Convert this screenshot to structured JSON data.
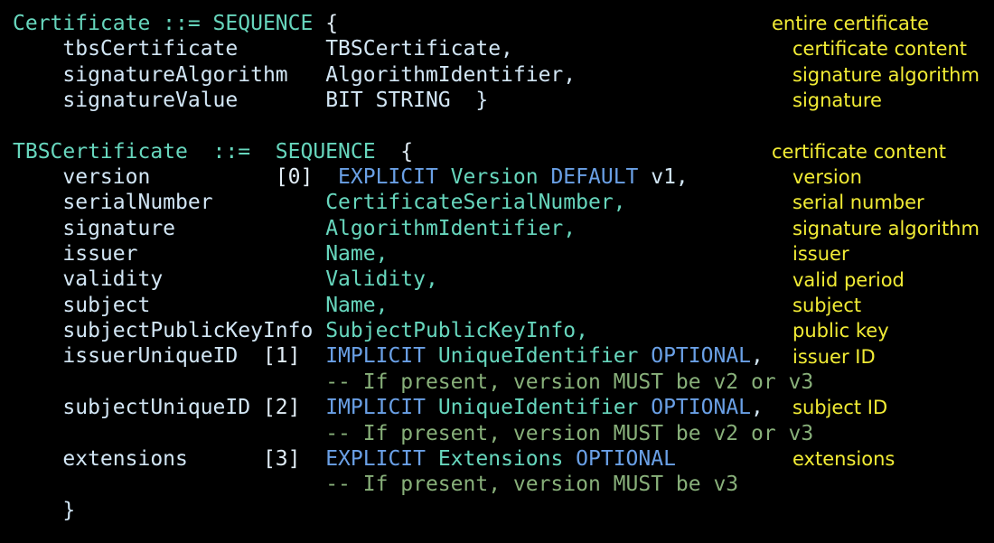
{
  "code": [
    [
      {
        "t": "Certificate ::= SEQUENCE ",
        "c": "kw-type"
      },
      {
        "t": "{",
        "c": "punct"
      }
    ],
    [
      {
        "t": "    tbsCertificate       ",
        "c": "field"
      },
      {
        "t": "TBSCertificate,",
        "c": "field"
      }
    ],
    [
      {
        "t": "    signatureAlgorithm   ",
        "c": "field"
      },
      {
        "t": "AlgorithmIdentifier,",
        "c": "field"
      }
    ],
    [
      {
        "t": "    signatureValue       ",
        "c": "field"
      },
      {
        "t": "BIT STRING  }",
        "c": "field"
      }
    ],
    [],
    [
      {
        "t": "TBSCertificate  ::=  SEQUENCE  ",
        "c": "kw-type"
      },
      {
        "t": "{",
        "c": "punct"
      }
    ],
    [
      {
        "t": "    version          ",
        "c": "field"
      },
      {
        "t": "[0]  ",
        "c": "punct"
      },
      {
        "t": "EXPLICIT ",
        "c": "kw-blue"
      },
      {
        "t": "Version ",
        "c": "kw-type"
      },
      {
        "t": "DEFAULT ",
        "c": "kw-blue"
      },
      {
        "t": "v1,",
        "c": "field"
      }
    ],
    [
      {
        "t": "    serialNumber         ",
        "c": "field"
      },
      {
        "t": "CertificateSerialNumber,",
        "c": "kw-type"
      }
    ],
    [
      {
        "t": "    signature            ",
        "c": "field"
      },
      {
        "t": "AlgorithmIdentifier,",
        "c": "kw-type"
      }
    ],
    [
      {
        "t": "    issuer               ",
        "c": "field"
      },
      {
        "t": "Name,",
        "c": "kw-type"
      }
    ],
    [
      {
        "t": "    validity             ",
        "c": "field"
      },
      {
        "t": "Validity,",
        "c": "kw-type"
      }
    ],
    [
      {
        "t": "    subject              ",
        "c": "field"
      },
      {
        "t": "Name,",
        "c": "kw-type"
      }
    ],
    [
      {
        "t": "    subjectPublicKeyInfo ",
        "c": "field"
      },
      {
        "t": "SubjectPublicKeyInfo,",
        "c": "kw-type"
      }
    ],
    [
      {
        "t": "    issuerUniqueID  ",
        "c": "field"
      },
      {
        "t": "[1]  ",
        "c": "punct"
      },
      {
        "t": "IMPLICIT ",
        "c": "kw-blue"
      },
      {
        "t": "UniqueIdentifier ",
        "c": "kw-type"
      },
      {
        "t": "OPTIONAL",
        "c": "kw-blue"
      },
      {
        "t": ",",
        "c": "field"
      }
    ],
    [
      {
        "t": "                         ",
        "c": "field"
      },
      {
        "t": "-- If present, version MUST be v2 or v3",
        "c": "comment"
      }
    ],
    [
      {
        "t": "    subjectUniqueID ",
        "c": "field"
      },
      {
        "t": "[2]  ",
        "c": "punct"
      },
      {
        "t": "IMPLICIT ",
        "c": "kw-blue"
      },
      {
        "t": "UniqueIdentifier ",
        "c": "kw-type"
      },
      {
        "t": "OPTIONAL",
        "c": "kw-blue"
      },
      {
        "t": ",",
        "c": "field"
      }
    ],
    [
      {
        "t": "                         ",
        "c": "field"
      },
      {
        "t": "-- If present, version MUST be v2 or v3",
        "c": "comment"
      }
    ],
    [
      {
        "t": "    extensions      ",
        "c": "field"
      },
      {
        "t": "[3]  ",
        "c": "punct"
      },
      {
        "t": "EXPLICIT ",
        "c": "kw-blue"
      },
      {
        "t": "Extensions ",
        "c": "kw-type"
      },
      {
        "t": "OPTIONAL",
        "c": "kw-blue"
      }
    ],
    [
      {
        "t": "                         ",
        "c": "field"
      },
      {
        "t": "-- If present, version MUST be v3",
        "c": "comment"
      }
    ],
    [
      {
        "t": "    }",
        "c": "field"
      }
    ]
  ],
  "notes": [
    {
      "text": "entire certificate",
      "line": 0,
      "indent": false
    },
    {
      "text": "certificate content",
      "line": 1,
      "indent": true
    },
    {
      "text": "signature algorithm",
      "line": 2,
      "indent": true
    },
    {
      "text": "signature",
      "line": 3,
      "indent": true
    },
    {
      "text": "certificate content",
      "line": 5,
      "indent": false
    },
    {
      "text": "version",
      "line": 6,
      "indent": true
    },
    {
      "text": "serial number",
      "line": 7,
      "indent": true
    },
    {
      "text": "signature algorithm",
      "line": 8,
      "indent": true
    },
    {
      "text": "issuer",
      "line": 9,
      "indent": true
    },
    {
      "text": "valid period",
      "line": 10,
      "indent": true
    },
    {
      "text": "subject",
      "line": 11,
      "indent": true
    },
    {
      "text": "public key",
      "line": 12,
      "indent": true
    },
    {
      "text": "issuer ID",
      "line": 13,
      "indent": true
    },
    {
      "text": "subject ID",
      "line": 15,
      "indent": true
    },
    {
      "text": "extensions",
      "line": 17,
      "indent": true
    }
  ],
  "colors": {
    "background": "#000000",
    "type_keyword": "#67d6bd",
    "blue_keyword": "#6aa0e6",
    "field": "#d2e6f5",
    "comment": "#88b07a",
    "annotation": "#f2ec35"
  }
}
